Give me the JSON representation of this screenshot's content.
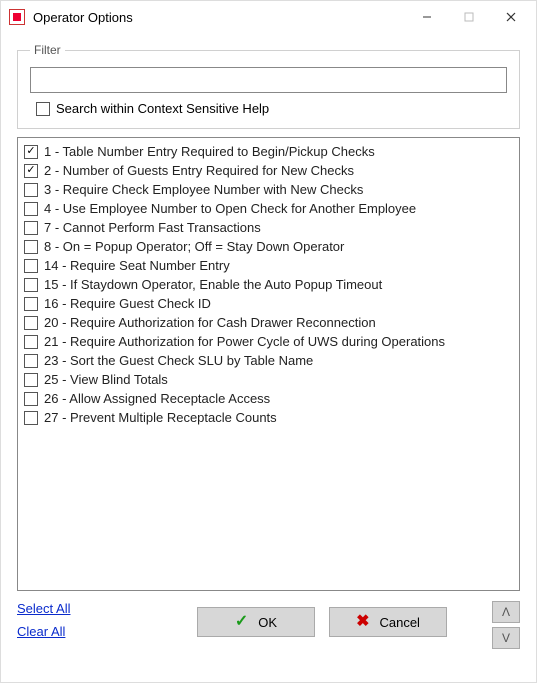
{
  "window": {
    "title": "Operator Options"
  },
  "filter": {
    "legend": "Filter",
    "value": "",
    "search_within_label": "Search within Context Sensitive Help",
    "search_within_checked": false
  },
  "options": [
    {
      "checked": true,
      "label": "1 - Table Number Entry Required to Begin/Pickup Checks"
    },
    {
      "checked": true,
      "label": "2 - Number of Guests Entry Required for New Checks"
    },
    {
      "checked": false,
      "label": "3 - Require Check Employee Number with New Checks"
    },
    {
      "checked": false,
      "label": "4 - Use Employee Number to Open Check for Another Employee"
    },
    {
      "checked": false,
      "label": "7 - Cannot Perform Fast Transactions"
    },
    {
      "checked": false,
      "label": "8 - On = Popup Operator; Off = Stay Down Operator"
    },
    {
      "checked": false,
      "label": "14 - Require Seat Number Entry"
    },
    {
      "checked": false,
      "label": "15 - If Staydown Operator, Enable the Auto Popup Timeout"
    },
    {
      "checked": false,
      "label": "16 - Require Guest Check ID"
    },
    {
      "checked": false,
      "label": "20 - Require Authorization for Cash Drawer Reconnection"
    },
    {
      "checked": false,
      "label": "21 - Require Authorization for Power Cycle of UWS during Operations"
    },
    {
      "checked": false,
      "label": "23 - Sort the Guest Check SLU by Table Name"
    },
    {
      "checked": false,
      "label": "25 - View Blind Totals"
    },
    {
      "checked": false,
      "label": "26 - Allow Assigned Receptacle Access"
    },
    {
      "checked": false,
      "label": "27 - Prevent Multiple Receptacle Counts"
    }
  ],
  "links": {
    "select_all": "Select All",
    "clear_all": "Clear All"
  },
  "buttons": {
    "ok": "OK",
    "cancel": "Cancel"
  }
}
